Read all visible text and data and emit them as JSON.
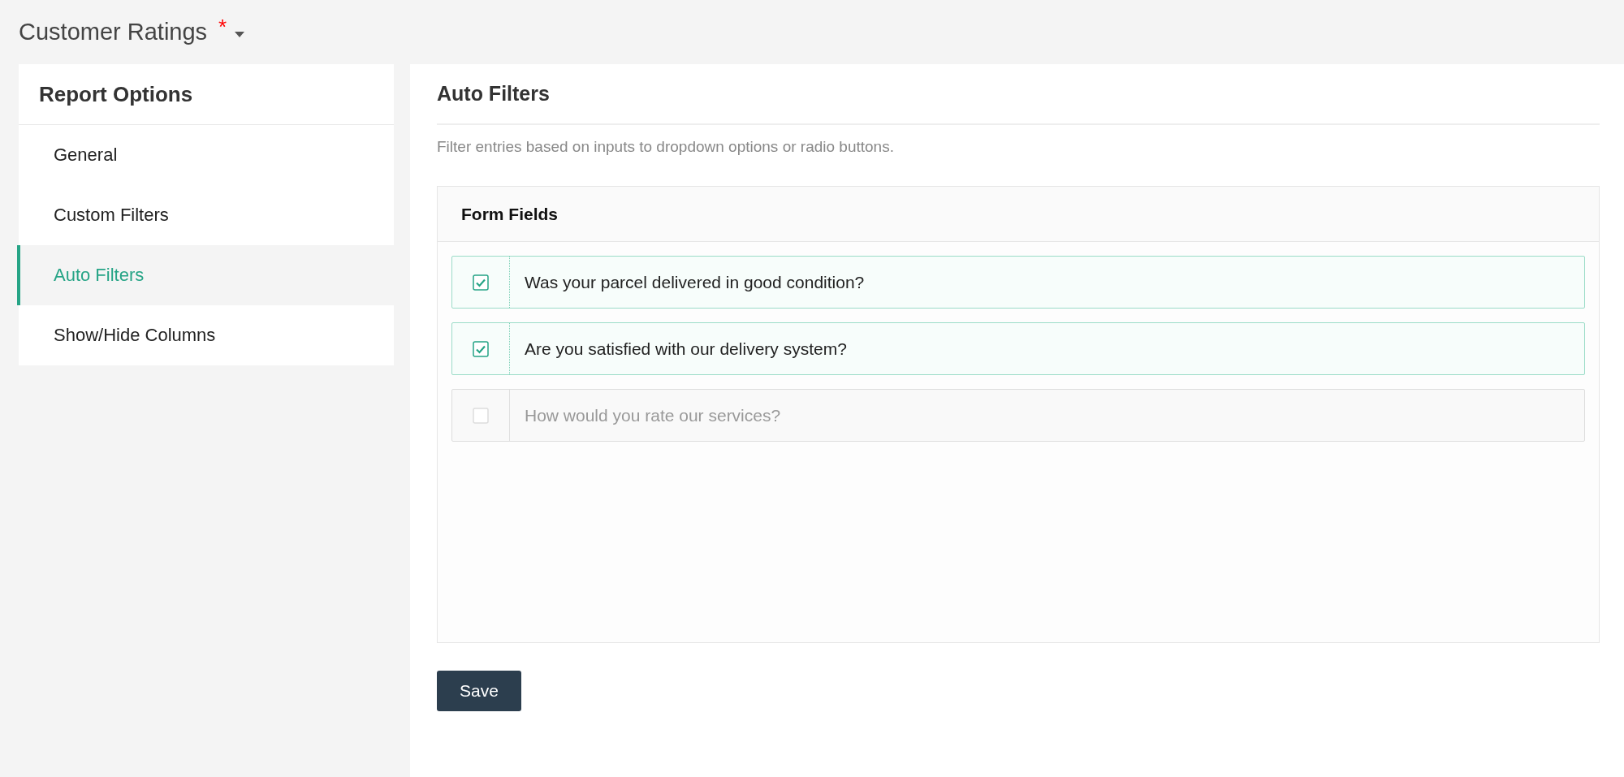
{
  "header": {
    "title": "Customer Ratings",
    "required_mark": "*"
  },
  "sidebar": {
    "title": "Report Options",
    "items": [
      {
        "label": "General",
        "selected": false
      },
      {
        "label": "Custom Filters",
        "selected": false
      },
      {
        "label": "Auto Filters",
        "selected": true
      },
      {
        "label": "Show/Hide Columns",
        "selected": false
      }
    ]
  },
  "main": {
    "title": "Auto Filters",
    "description": "Filter entries based on inputs to dropdown options or radio buttons.",
    "form_fields": {
      "title": "Form Fields",
      "items": [
        {
          "label": "Was your parcel delivered in good condition?",
          "checked": true
        },
        {
          "label": "Are you satisfied with our delivery system?",
          "checked": true
        },
        {
          "label": "How would you rate our services?",
          "checked": false
        }
      ]
    },
    "save_button": "Save"
  }
}
